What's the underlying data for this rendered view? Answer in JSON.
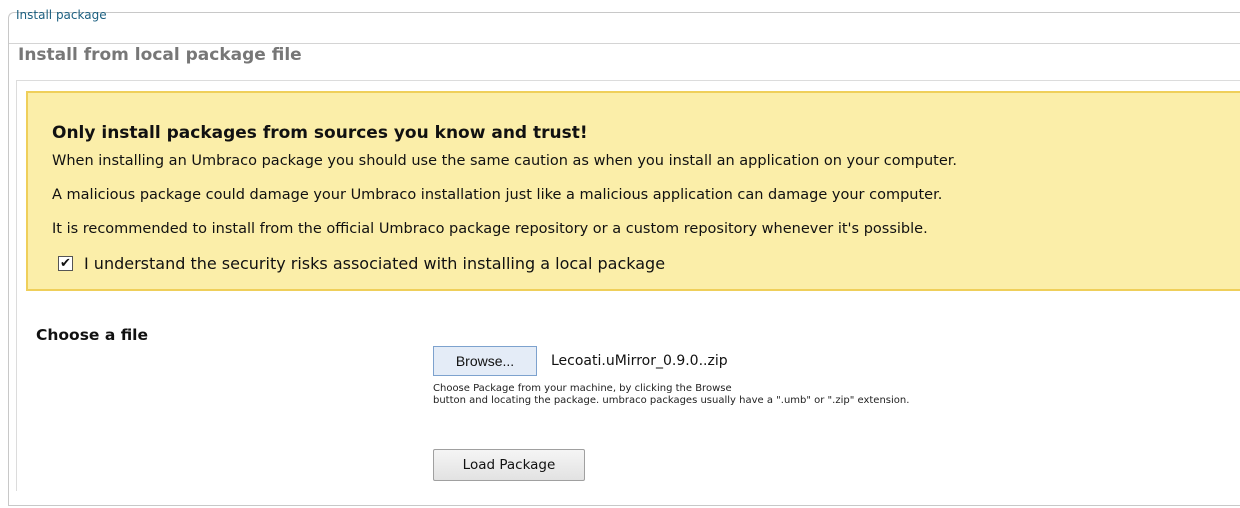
{
  "tab": {
    "label": "Install package"
  },
  "section": {
    "title": "Install from local package file"
  },
  "warning": {
    "heading": "Only install packages from sources you know and trust!",
    "lines": [
      "When installing an Umbraco package you should use the same caution as when you install an application on your computer.",
      "A malicious package could damage your Umbraco installation just like a malicious application can damage your computer.",
      "It is recommended to install from the official Umbraco package repository or a custom repository whenever it's possible."
    ],
    "acknowledge": {
      "checked": true,
      "mark": "✔",
      "label": "I understand the security risks associated with installing a local package"
    }
  },
  "file": {
    "label": "Choose a file",
    "browse_label": "Browse...",
    "selected_filename": "Lecoati.uMirror_0.9.0..zip",
    "help_line1": "Choose Package from your machine, by clicking the Browse",
    "help_line2": "button and locating the package. umbraco packages usually have a \".umb\" or \".zip\" extension."
  },
  "actions": {
    "load_label": "Load Package"
  },
  "colors": {
    "warning_bg": "#fbeea9",
    "warning_border": "#efcf5a",
    "tab_text": "#1b5f80"
  }
}
